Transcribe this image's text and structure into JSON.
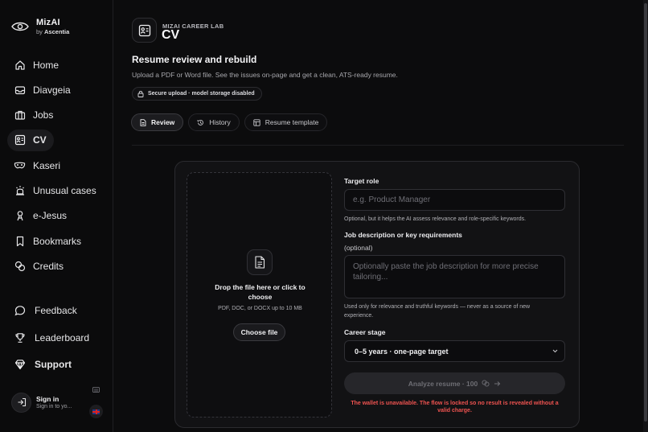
{
  "brand": {
    "name": "MizAI",
    "by_prefix": "by",
    "by_name": "Ascentia"
  },
  "nav": [
    {
      "label": "Home",
      "icon": "home-icon"
    },
    {
      "label": "Diavgeia",
      "icon": "inbox-icon"
    },
    {
      "label": "Jobs",
      "icon": "briefcase-icon"
    },
    {
      "label": "CV",
      "icon": "id-card-icon",
      "active": true
    },
    {
      "label": "Kaseri",
      "icon": "mask-icon"
    },
    {
      "label": "Unusual cases",
      "icon": "siren-icon"
    },
    {
      "label": "e-Jesus",
      "icon": "person-icon"
    },
    {
      "label": "Bookmarks",
      "icon": "bookmark-icon"
    },
    {
      "label": "Credits",
      "icon": "coins-icon"
    }
  ],
  "nav_secondary": [
    {
      "label": "Feedback",
      "icon": "chat-bubble-icon"
    },
    {
      "label": "Leaderboard",
      "icon": "trophy-icon"
    },
    {
      "label": "Support",
      "icon": "gem-icon"
    }
  ],
  "signin": {
    "title": "Sign in",
    "subtitle": "Sign in to yo..."
  },
  "header": {
    "eyebrow": "MIZAI CAREER LAB",
    "title": "CV",
    "heading": "Resume review and rebuild",
    "subtitle": "Upload a PDF or Word file. See the issues on-page and get a clean, ATS-ready resume.",
    "secure_badge": "Secure upload · model storage disabled"
  },
  "tabs": [
    {
      "label": "Review",
      "active": true
    },
    {
      "label": "History"
    },
    {
      "label": "Resume template"
    }
  ],
  "upload": {
    "title": "Drop the file here or click to choose",
    "formats": "PDF, DOC, or DOCX up to 10 MB",
    "button": "Choose file"
  },
  "form": {
    "target_role_label": "Target role",
    "target_role_placeholder": "e.g. Product Manager",
    "target_role_hint": "Optional, but it helps the AI assess relevance and role-specific keywords.",
    "jd_label": "Job description or key requirements",
    "jd_optional": "(optional)",
    "jd_placeholder": "Optionally paste the job description for more precise tailoring...",
    "jd_hint": "Used only for relevance and truthful keywords — never as a source of new experience.",
    "career_stage_label": "Career stage",
    "career_stage_value": "0–5 years · one-page target",
    "analyze_label": "Analyze resume · 100",
    "warning": "The wallet is unavailable. The flow is locked so no result is revealed without a valid charge."
  },
  "colors": {
    "background": "#0c0c0d",
    "warning": "#ef5350",
    "accent": "#f6f6f8"
  }
}
